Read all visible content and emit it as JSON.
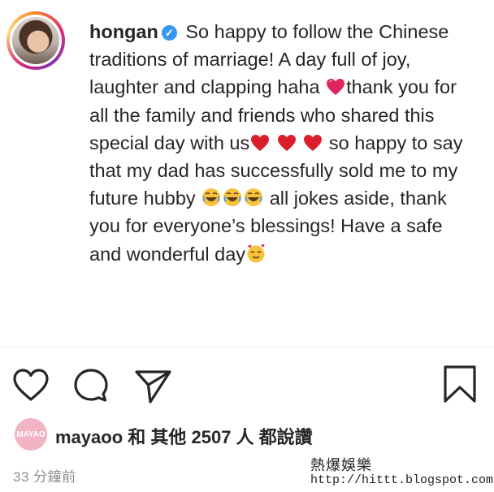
{
  "post": {
    "username": "hongan",
    "verified": true,
    "caption": {
      "part1": "So happy to follow the Chinese traditions of marriage! A day full of joy, laughter and clapping haha",
      "part2": "thank you for all the family and friends who shared this special day with us",
      "part3": "so happy to say that my dad has successfully sold me to my future hubby",
      "part4": "all jokes aside, thank you for everyone’s blessings! Have a safe and wonderful day"
    }
  },
  "likes": {
    "avatar_text": "MAYAO",
    "text": "mayaoo 和 其他 2507 人 都說讚"
  },
  "timestamp": "33 分鐘前",
  "watermark": {
    "line1": "熱爆娛樂",
    "line2": "http://hittt.blogspot.com"
  },
  "icons": [
    "heart-outline-icon",
    "comment-icon",
    "share-icon",
    "bookmark-icon",
    "verified-badge-icon",
    "heart-emoji-icon",
    "laughing-emoji-icon",
    "smiling-hearts-emoji-icon"
  ]
}
